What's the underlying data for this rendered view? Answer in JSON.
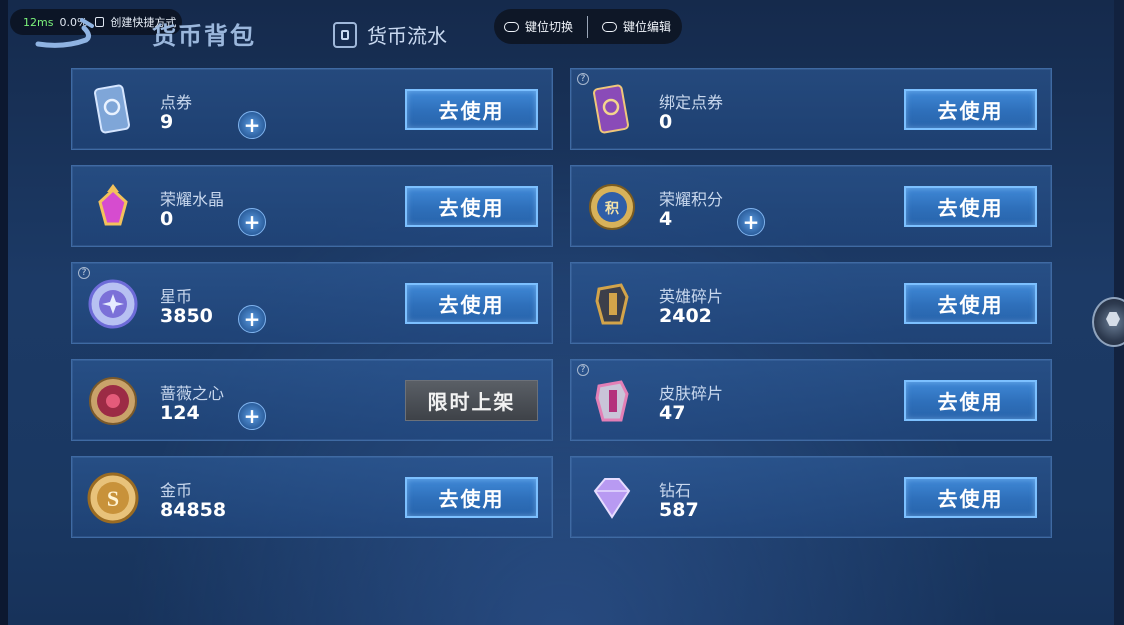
{
  "overlay": {
    "latency": "12ms",
    "percent": "0.0%",
    "shortcut_label": "创建快捷方式"
  },
  "tabs": {
    "wallet": "货币背包",
    "flow": "货币流水"
  },
  "keymap": {
    "switch": "键位切换",
    "edit": "键位编辑"
  },
  "currencies": [
    {
      "name": "点券",
      "amount": "9",
      "plus": true,
      "button": "去使用",
      "help": false,
      "icon": "ticket-icon"
    },
    {
      "name": "绑定点券",
      "amount": "0",
      "plus": false,
      "button": "去使用",
      "help": true,
      "icon": "bound-ticket-icon"
    },
    {
      "name": "荣耀水晶",
      "amount": "0",
      "plus": true,
      "button": "去使用",
      "help": false,
      "icon": "glory-crystal-icon"
    },
    {
      "name": "荣耀积分",
      "amount": "4",
      "plus": true,
      "button": "去使用",
      "help": false,
      "icon": "glory-points-icon"
    },
    {
      "name": "星币",
      "amount": "3850",
      "plus": true,
      "button": "去使用",
      "help": true,
      "icon": "star-coin-icon"
    },
    {
      "name": "英雄碎片",
      "amount": "2402",
      "plus": false,
      "button": "去使用",
      "help": false,
      "icon": "hero-fragment-icon"
    },
    {
      "name": "蔷薇之心",
      "amount": "124",
      "plus": true,
      "button": "限时上架",
      "help": false,
      "icon": "rose-heart-icon",
      "limited": true
    },
    {
      "name": "皮肤碎片",
      "amount": "47",
      "plus": false,
      "button": "去使用",
      "help": true,
      "icon": "skin-fragment-icon"
    },
    {
      "name": "金币",
      "amount": "84858",
      "plus": false,
      "button": "去使用",
      "help": false,
      "icon": "gold-coin-icon"
    },
    {
      "name": "钻石",
      "amount": "587",
      "plus": false,
      "button": "去使用",
      "help": false,
      "icon": "diamond-icon"
    }
  ],
  "plus_symbol": "+",
  "help_symbol": "?"
}
